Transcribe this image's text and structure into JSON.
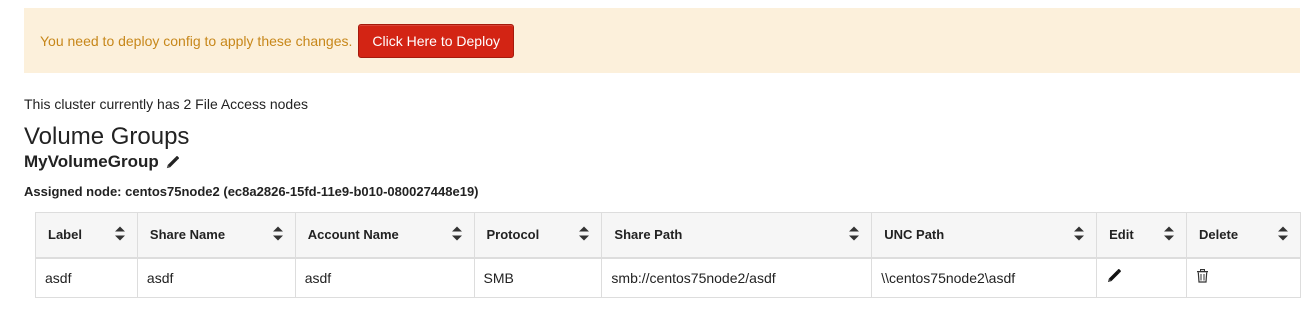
{
  "alert": {
    "message": "You need to deploy config to apply these changes.",
    "deploy_label": "Click Here to Deploy"
  },
  "cluster": {
    "node_count_text": "This cluster currently has 2 File Access nodes"
  },
  "section": {
    "title": "Volume Groups"
  },
  "volume_group": {
    "name": "MyVolumeGroup",
    "edit_icon": "pencil-icon",
    "assigned_node": "Assigned node: centos75node2 (ec8a2826-15fd-11e9-b010-080027448e19)"
  },
  "table": {
    "columns": [
      "Label",
      "Share Name",
      "Account Name",
      "Protocol",
      "Share Path",
      "UNC Path",
      "Edit",
      "Delete"
    ],
    "sort_icon": "sort-updown-icon",
    "rows": [
      {
        "label": "asdf",
        "share_name": "asdf",
        "account_name": "asdf",
        "protocol": "SMB",
        "share_path": "smb://centos75node2/asdf",
        "unc_path": "\\\\centos75node2\\asdf",
        "edit_icon": "pencil-icon",
        "delete_icon": "trash-icon"
      }
    ]
  },
  "colors": {
    "alert_bg": "#fcf0db",
    "alert_text": "#c7871a",
    "deploy_button": "#d32414"
  }
}
